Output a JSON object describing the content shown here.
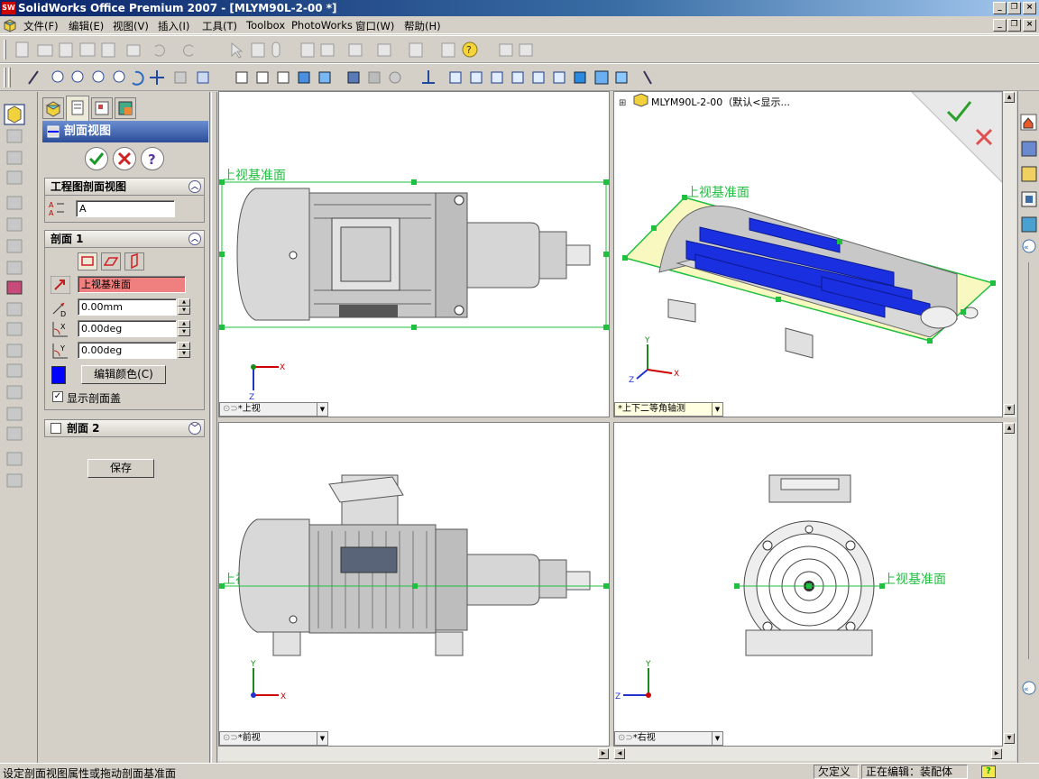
{
  "window": {
    "title": "SolidWorks Office Premium 2007 - [MLYM90L-2-00 *]",
    "app_icon_text": "SW"
  },
  "menu": [
    {
      "label": "文件(F)"
    },
    {
      "label": "编辑(E)"
    },
    {
      "label": "视图(V)"
    },
    {
      "label": "插入(I)"
    },
    {
      "label": "工具(T)"
    },
    {
      "label": "Toolbox"
    },
    {
      "label": "PhotoWorks"
    },
    {
      "label": "窗口(W)"
    },
    {
      "label": "帮助(H)"
    }
  ],
  "property_manager": {
    "title": "剖面视图",
    "group_section_view": {
      "title": "工程图剖面视图",
      "name_value": "A"
    },
    "group_section1": {
      "title": "剖面 1",
      "plane_value": "上视基准面",
      "distance_value": "0.00mm",
      "x_rotation_value": "0.00deg",
      "y_rotation_value": "0.00deg",
      "edit_color_label": "编辑颜色(C)",
      "section_color": "#0000ff",
      "show_cap_label": "显示剖面盖",
      "show_cap_checked": true
    },
    "group_section2": {
      "title": "剖面 2",
      "checked": false
    },
    "save_label": "保存"
  },
  "viewports": {
    "top": {
      "name": "*上视",
      "plane_label": "上视基准面",
      "axis_x": "X",
      "axis_z": "Z"
    },
    "iso": {
      "name": "*上下二等角轴测",
      "plane_label": "上视基准面",
      "tree_item": "MLYM90L-2-00（默认<显示...",
      "axis_x": "X",
      "axis_y": "Y",
      "axis_z": "Z"
    },
    "front": {
      "name": "*前视",
      "plane_label": "上视基准面",
      "axis_x": "X",
      "axis_y": "Y"
    },
    "right": {
      "name": "*右视",
      "plane_label": "上视基准面",
      "axis_z": "Z",
      "axis_y": "Y"
    }
  },
  "status": {
    "message": "设定剖面视图属性或拖动剖面基准面",
    "definition": "欠定义",
    "mode": "正在编辑：装配体",
    "help": "?"
  },
  "colors": {
    "plane_green": "#1fbf3f",
    "section_blue": "#1a2fe0",
    "highlight_field": "#f08080"
  }
}
